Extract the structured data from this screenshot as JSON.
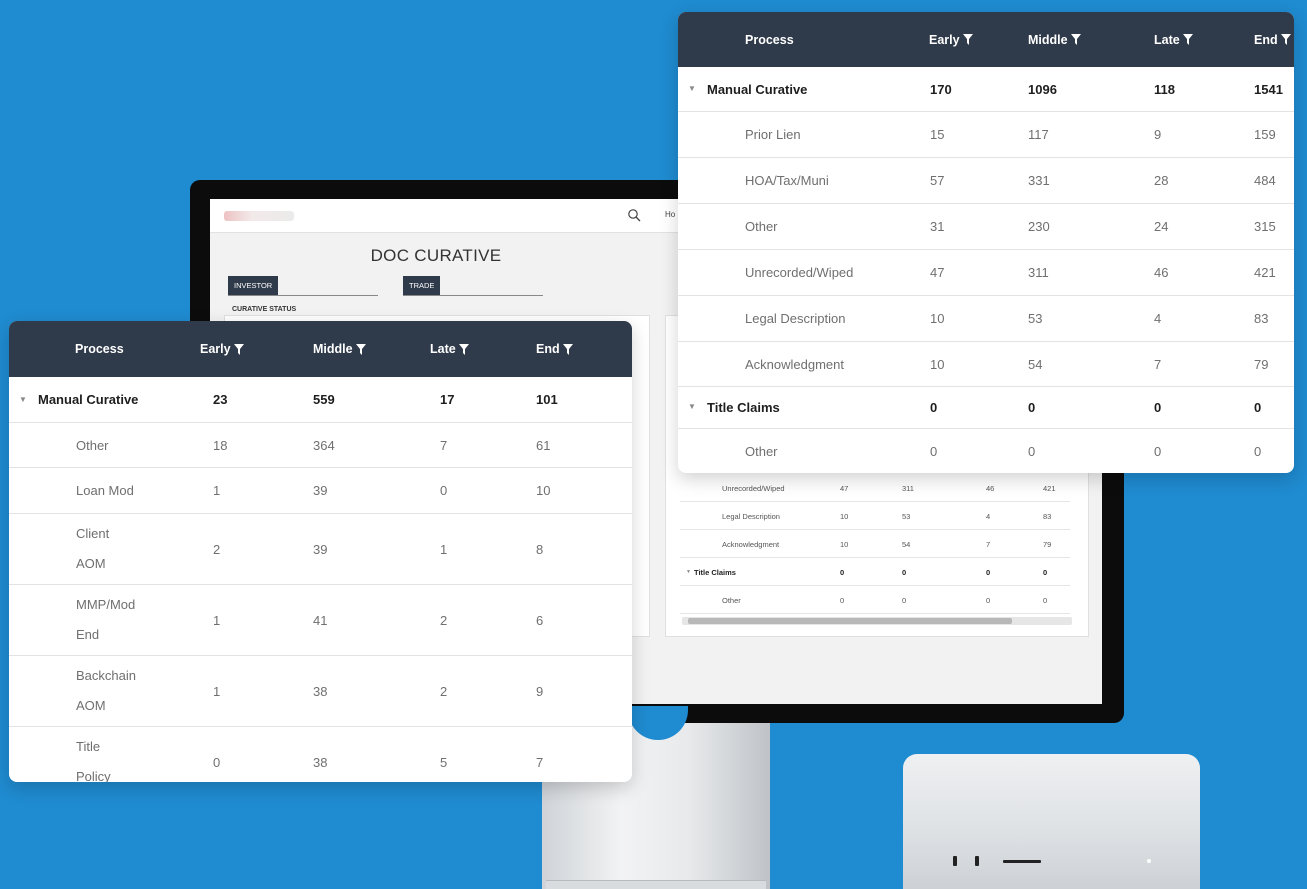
{
  "background_color": "#1f8bd0",
  "header_color": "#2f3a4a",
  "icons": [
    "search-icon",
    "filter-icon",
    "caret-down-icon"
  ],
  "monitor_app": {
    "nav_text": "Ho",
    "page_title": "DOC CURATIVE",
    "filters": [
      "INVESTOR",
      "TRADE"
    ],
    "section_label": "CURATIVE STATUS",
    "table": {
      "rows": [
        {
          "label": "Unrecorded/Wiped",
          "early": "47",
          "middle": "311",
          "late": "46",
          "end": "421"
        },
        {
          "label": "Legal Description",
          "early": "10",
          "middle": "53",
          "late": "4",
          "end": "83"
        },
        {
          "label": "Acknowledgment",
          "early": "10",
          "middle": "54",
          "late": "7",
          "end": "79"
        },
        {
          "label": "Title Claims",
          "early": "0",
          "middle": "0",
          "late": "0",
          "end": "0"
        },
        {
          "label": "Other",
          "early": "0",
          "middle": "0",
          "late": "0",
          "end": "0"
        }
      ]
    }
  },
  "left_table": {
    "headers": {
      "process": "Process",
      "early": "Early",
      "middle": "Middle",
      "late": "Late",
      "end": "End"
    },
    "rows": [
      {
        "label": "Manual Curative",
        "early": "23",
        "middle": "559",
        "late": "17",
        "end": "101"
      },
      {
        "label": "Other",
        "early": "18",
        "middle": "364",
        "late": "7",
        "end": "61"
      },
      {
        "label": "Loan Mod",
        "early": "1",
        "middle": "39",
        "late": "0",
        "end": "10"
      },
      {
        "label_line1": "Client",
        "label_line2": "AOM",
        "early": "2",
        "middle": "39",
        "late": "1",
        "end": "8"
      },
      {
        "label_line1": "MMP/Mod",
        "label_line2": "End",
        "early": "1",
        "middle": "41",
        "late": "2",
        "end": "6"
      },
      {
        "label_line1": "Backchain",
        "label_line2": "AOM",
        "early": "1",
        "middle": "38",
        "late": "2",
        "end": "9"
      },
      {
        "label_line1": "Title",
        "label_line2": "Policy",
        "early": "0",
        "middle": "38",
        "late": "5",
        "end": "7"
      }
    ]
  },
  "right_table": {
    "headers": {
      "process": "Process",
      "early": "Early",
      "middle": "Middle",
      "late": "Late",
      "end": "End"
    },
    "rows": [
      {
        "label": "Manual Curative",
        "early": "170",
        "middle": "1096",
        "late": "118",
        "end": "1541"
      },
      {
        "label": "Prior Lien",
        "early": "15",
        "middle": "117",
        "late": "9",
        "end": "159"
      },
      {
        "label": "HOA/Tax/Muni",
        "early": "57",
        "middle": "331",
        "late": "28",
        "end": "484"
      },
      {
        "label": "Other",
        "early": "31",
        "middle": "230",
        "late": "24",
        "end": "315"
      },
      {
        "label": "Unrecorded/Wiped",
        "early": "47",
        "middle": "311",
        "late": "46",
        "end": "421"
      },
      {
        "label": "Legal Description",
        "early": "10",
        "middle": "53",
        "late": "4",
        "end": "83"
      },
      {
        "label": "Acknowledgment",
        "early": "10",
        "middle": "54",
        "late": "7",
        "end": "79"
      },
      {
        "label": "Title Claims",
        "early": "0",
        "middle": "0",
        "late": "0",
        "end": "0"
      },
      {
        "label": "Other",
        "early": "0",
        "middle": "0",
        "late": "0",
        "end": "0"
      }
    ]
  }
}
